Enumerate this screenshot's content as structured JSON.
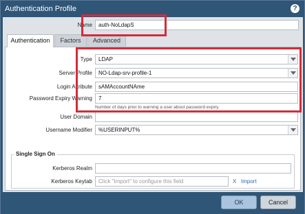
{
  "window": {
    "title": "Authentication Profile"
  },
  "name": {
    "label": "Name",
    "value": "auth-NoLdapS"
  },
  "tabs": [
    {
      "label": "Authentication"
    },
    {
      "label": "Factors"
    },
    {
      "label": "Advanced"
    }
  ],
  "auth": {
    "type": {
      "label": "Type",
      "value": "LDAP"
    },
    "server_profile": {
      "label": "Server Profile",
      "value": "NO-Ldap-srv-profile-1"
    },
    "login_attribute": {
      "label": "Login Attribute",
      "value": "sAMAccountNAme"
    },
    "password_expiry": {
      "label": "Password Expiry Warning",
      "value": "7",
      "hint": "Number of days prior to warning a user about password expiry."
    },
    "user_domain": {
      "label": "User Domain",
      "value": ""
    },
    "username_modifier": {
      "label": "Username Modifier",
      "value": "%USERINPUT%"
    }
  },
  "sso": {
    "title": "Single Sign On",
    "kerberos_realm": {
      "label": "Kerberos Realm",
      "value": ""
    },
    "kerberos_keytab": {
      "label": "Kerberos Keytab",
      "placeholder": "Click \"Import\" to configure this field"
    },
    "clear_glyph": "X",
    "import_label": "Import"
  },
  "buttons": {
    "ok": "OK",
    "cancel": "Cancel"
  },
  "colors": {
    "titlebar": "#2f5577",
    "highlight": "#d22c3a",
    "link": "#2a6bb3"
  },
  "icons": {
    "help": "help-icon",
    "dropdown": "chevron-down-icon"
  }
}
